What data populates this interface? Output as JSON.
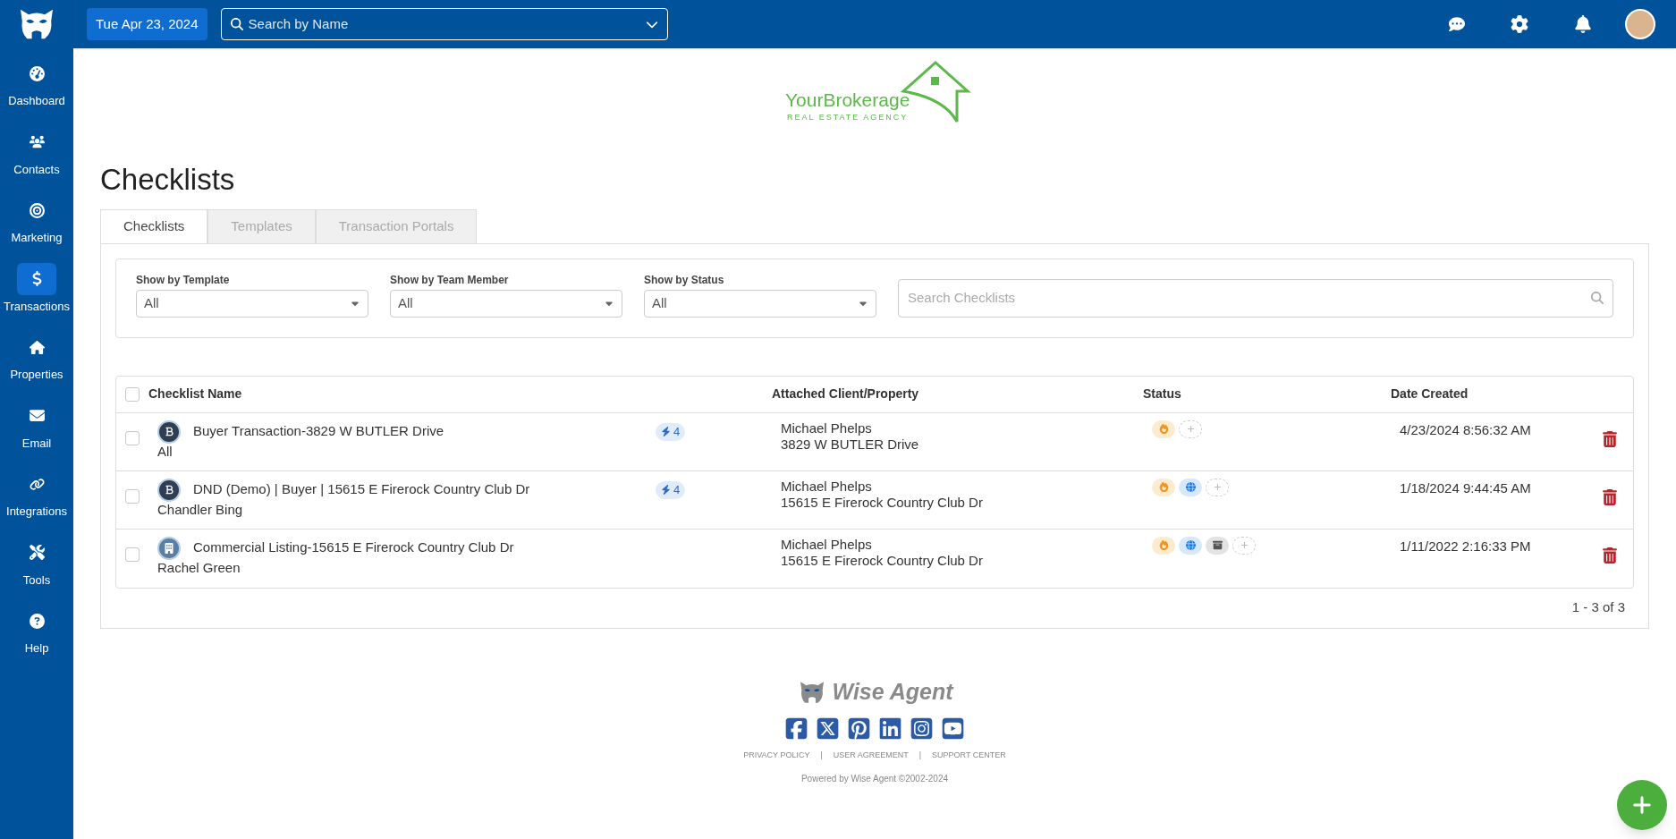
{
  "top_bar": {
    "date": "Tue Apr 23, 2024",
    "search": {
      "placeholder": "Search by Name"
    }
  },
  "sidebar": {
    "items": [
      {
        "label": "Dashboard",
        "selected": false
      },
      {
        "label": "Contacts",
        "selected": false
      },
      {
        "label": "Marketing",
        "selected": false
      },
      {
        "label": "Transactions",
        "selected": true
      },
      {
        "label": "Properties",
        "selected": false
      },
      {
        "label": "Email",
        "selected": false
      },
      {
        "label": "Integrations",
        "selected": false
      },
      {
        "label": "Tools",
        "selected": false
      },
      {
        "label": "Help",
        "selected": false
      }
    ]
  },
  "brand": {
    "name": "YourBrokerage",
    "tagline": "REAL ESTATE AGENCY"
  },
  "page_title": "Checklists",
  "tabs": [
    {
      "label": "Checklists",
      "selected": true
    },
    {
      "label": "Templates",
      "selected": false
    },
    {
      "label": "Transaction Portals",
      "selected": false
    }
  ],
  "filters": [
    {
      "label": "Show by Template",
      "value": "All"
    },
    {
      "label": "Show by Team Member",
      "value": "All"
    },
    {
      "label": "Show by Status",
      "value": "All"
    }
  ],
  "search": {
    "placeholder": "Search Checklists"
  },
  "table": {
    "select_all_checked": false,
    "columns": [
      "Checklist Name",
      "Attached Client/Property",
      "Status",
      "Date Created"
    ],
    "rows": [
      {
        "checked": false,
        "kind": "buyer",
        "name": "Buyer Transaction-3829 W BUTLER Drive",
        "member": "All",
        "badge": "4",
        "client": "Michael Phelps",
        "property": "3829 W BUTLER Drive",
        "statuses": [
          {
            "kind": "hot"
          },
          {
            "kind": "add"
          }
        ],
        "date": "4/23/2024 8:56:32 AM"
      },
      {
        "checked": false,
        "kind": "buyer",
        "name": "DND (Demo) | Buyer | 15615 E Firerock Country Club Dr",
        "member": "Chandler Bing",
        "badge": "4",
        "client": "Michael Phelps",
        "property": "15615 E Firerock Country Club Dr",
        "statuses": [
          {
            "kind": "hot"
          },
          {
            "kind": "web"
          },
          {
            "kind": "add"
          }
        ],
        "date": "1/18/2024 9:44:45 AM"
      },
      {
        "checked": false,
        "kind": "commercial",
        "name": "Commercial Listing-15615 E Firerock Country Club Dr",
        "member": "Rachel Green",
        "client": "Michael Phelps",
        "property": "15615 E Firerock Country Club Dr",
        "statuses": [
          {
            "kind": "hot"
          },
          {
            "kind": "web"
          },
          {
            "kind": "archive"
          },
          {
            "kind": "add"
          }
        ],
        "date": "1/11/2022 2:16:33 PM"
      }
    ],
    "pagination": "1 - 3 of 3"
  },
  "footer": {
    "logo": "Wise Agent",
    "links": [
      "PRIVACY POLICY",
      "USER AGREEMENT",
      "SUPPORT CENTER"
    ],
    "separator": "|",
    "powered": "Powered by Wise Agent ©2002-2024"
  }
}
